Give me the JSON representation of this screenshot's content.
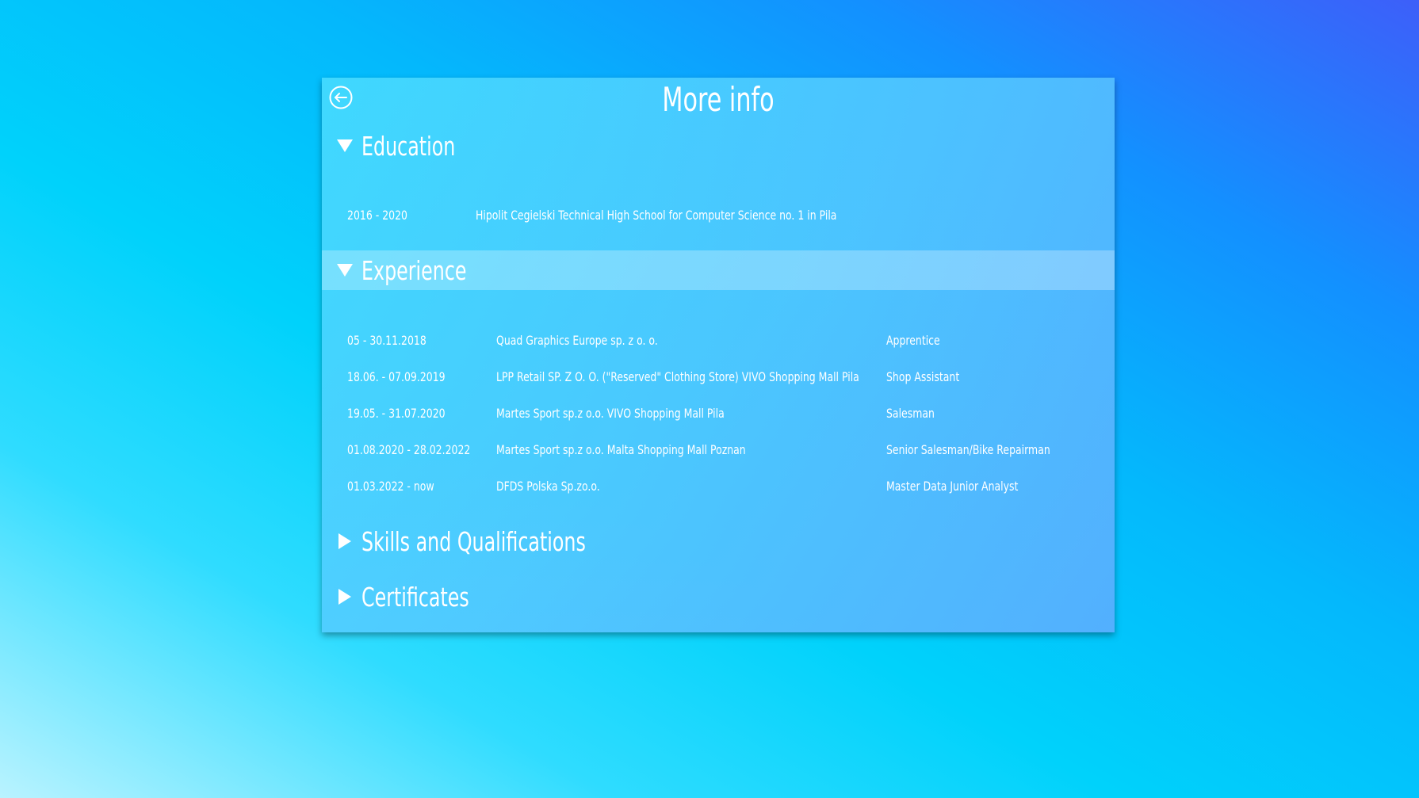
{
  "page": {
    "title": "More info",
    "back_icon": "arrow-left-circle-icon"
  },
  "sections": {
    "education": {
      "label": "Education",
      "expanded": true,
      "rows": [
        {
          "period": "2016 - 2020",
          "school": "Hipolit Cegielski Technical High School for Computer Science no. 1 in Pila"
        }
      ]
    },
    "experience": {
      "label": "Experience",
      "expanded": true,
      "rows": [
        {
          "period": "05 - 30.11.2018",
          "company": "Quad Graphics Europe sp. z o. o.",
          "position": "Apprentice"
        },
        {
          "period": "18.06. - 07.09.2019",
          "company": "LPP Retail SP. Z O. O. (\"Reserved\" Clothing Store) VIVO Shopping Mall Pila",
          "position": "Shop Assistant"
        },
        {
          "period": "19.05. - 31.07.2020",
          "company": "Martes Sport sp.z o.o. VIVO Shopping Mall Pila",
          "position": "Salesman"
        },
        {
          "period": "01.08.2020 - 28.02.2022",
          "company": "Martes Sport sp.z o.o. Malta Shopping Mall Poznan",
          "position": "Senior Salesman/Bike Repairman"
        },
        {
          "period": "01.03.2022 - now",
          "company": "DFDS Polska Sp.zo.o.",
          "position": "Master Data Junior Analyst"
        }
      ]
    },
    "skills": {
      "label": "Skills and Qualifications",
      "expanded": false
    },
    "certificates": {
      "label": "Certificates",
      "expanded": false
    }
  },
  "colors": {
    "text": "#ffffff",
    "active_header_overlay": "rgba(255,255,255,0.28)"
  }
}
